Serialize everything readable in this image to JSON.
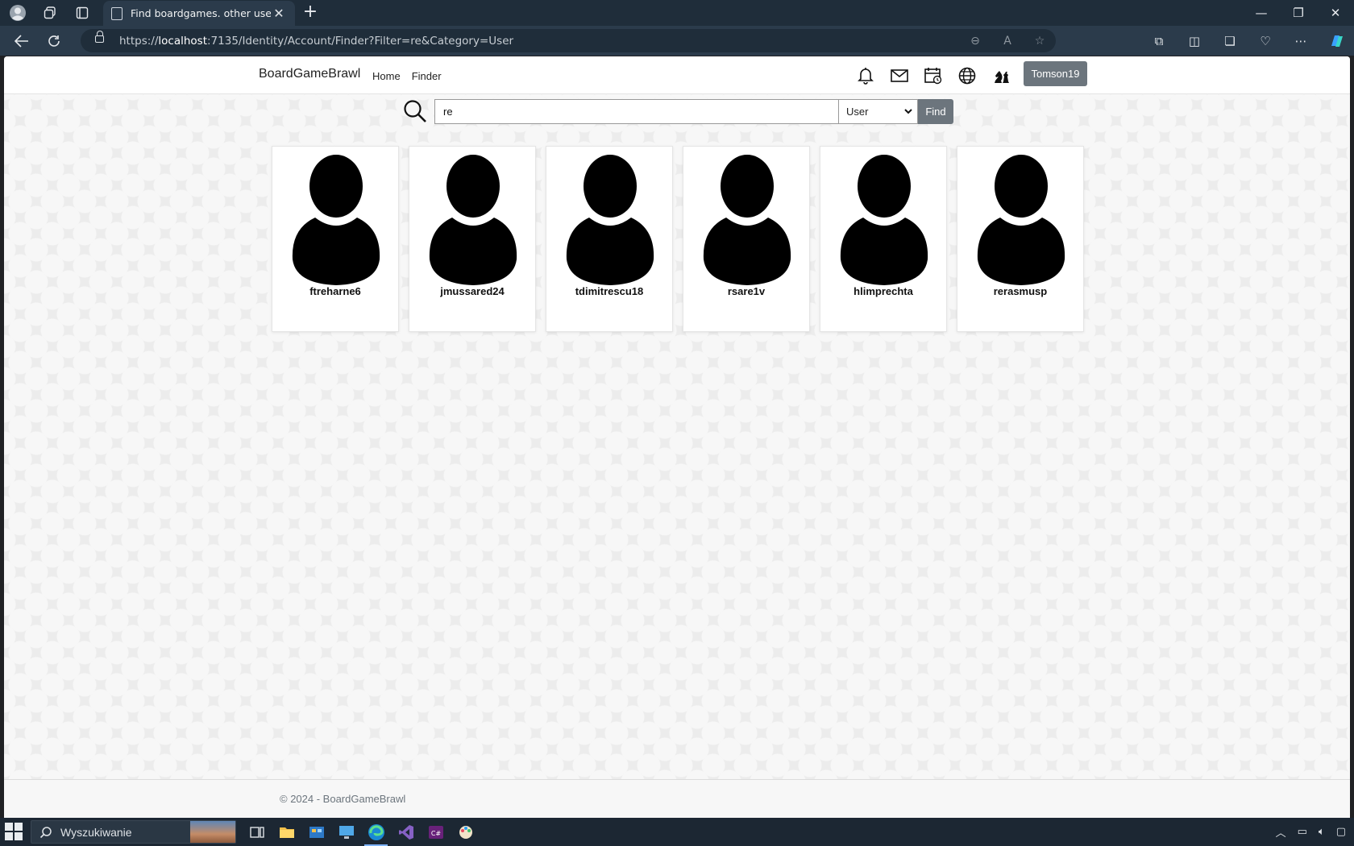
{
  "browser": {
    "tab_title": "Find boardgames. other users an",
    "url_prefix": "https://",
    "url_host": "localhost",
    "url_rest": ":7135/Identity/Account/Finder?Filter=re&Category=User"
  },
  "site": {
    "brand": "BoardGameBrawl",
    "nav": [
      "Home",
      "Finder"
    ],
    "user_button": "Tomson19"
  },
  "search": {
    "value": "re",
    "category": "User",
    "find_label": "Find"
  },
  "users": [
    {
      "name": "ftreharne6"
    },
    {
      "name": "jmussared24"
    },
    {
      "name": "tdimitrescu18"
    },
    {
      "name": "rsare1v"
    },
    {
      "name": "hlimprechta"
    },
    {
      "name": "rerasmusp"
    }
  ],
  "footer": {
    "text": "© 2024 - BoardGameBrawl"
  },
  "taskbar": {
    "search_placeholder": "Wyszukiwanie"
  },
  "colors": {
    "chrome_dark": "#1f2d3a",
    "chrome_bar": "#2b3b4b",
    "button_gray": "#6c757d",
    "page_bg": "#f7f7f7"
  }
}
